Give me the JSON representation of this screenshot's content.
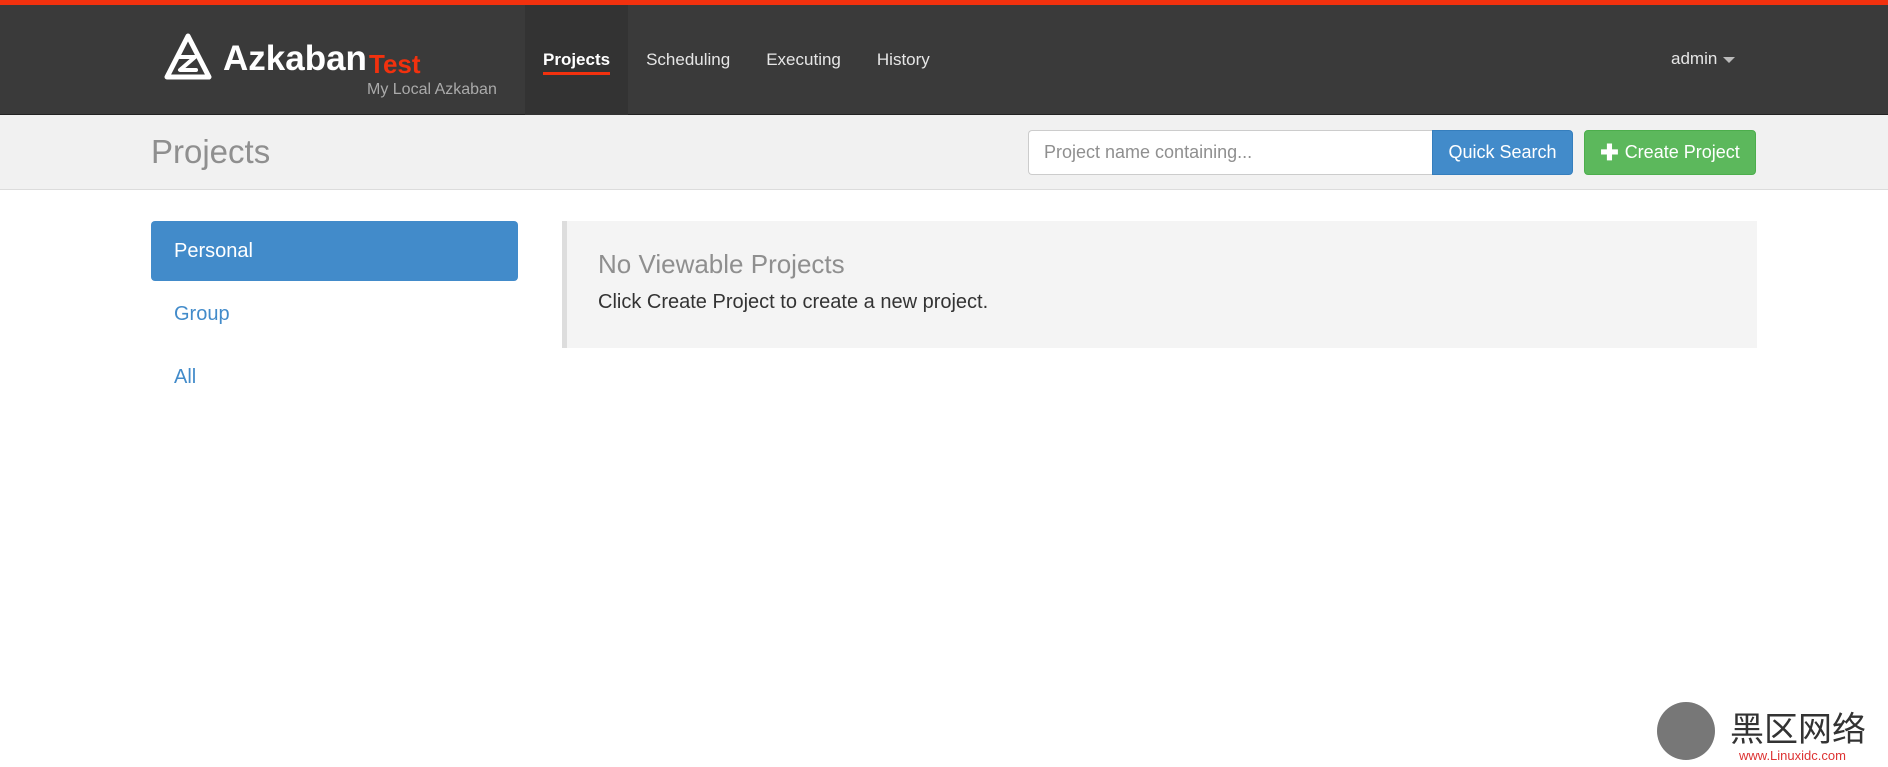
{
  "brand": {
    "name": "Azkaban",
    "env": "Test",
    "subtitle": "My Local Azkaban",
    "accent_color": "#f2310e"
  },
  "nav": {
    "items": [
      {
        "label": "Projects",
        "active": true
      },
      {
        "label": "Scheduling",
        "active": false
      },
      {
        "label": "Executing",
        "active": false
      },
      {
        "label": "History",
        "active": false
      }
    ],
    "user": "admin"
  },
  "header": {
    "title": "Projects",
    "search_placeholder": "Project name containing...",
    "search_value": "",
    "quick_search_label": "Quick Search",
    "create_project_label": "Create Project",
    "primary_color": "#428bca",
    "success_color": "#5cb85c"
  },
  "sidebar": {
    "items": [
      {
        "label": "Personal",
        "active": true
      },
      {
        "label": "Group",
        "active": false
      },
      {
        "label": "All",
        "active": false
      }
    ]
  },
  "main": {
    "empty_title": "No Viewable Projects",
    "empty_text": "Click Create Project to create a new project."
  },
  "watermark": {
    "text": "黑区网络",
    "url": "www.Linuxidc.com"
  }
}
